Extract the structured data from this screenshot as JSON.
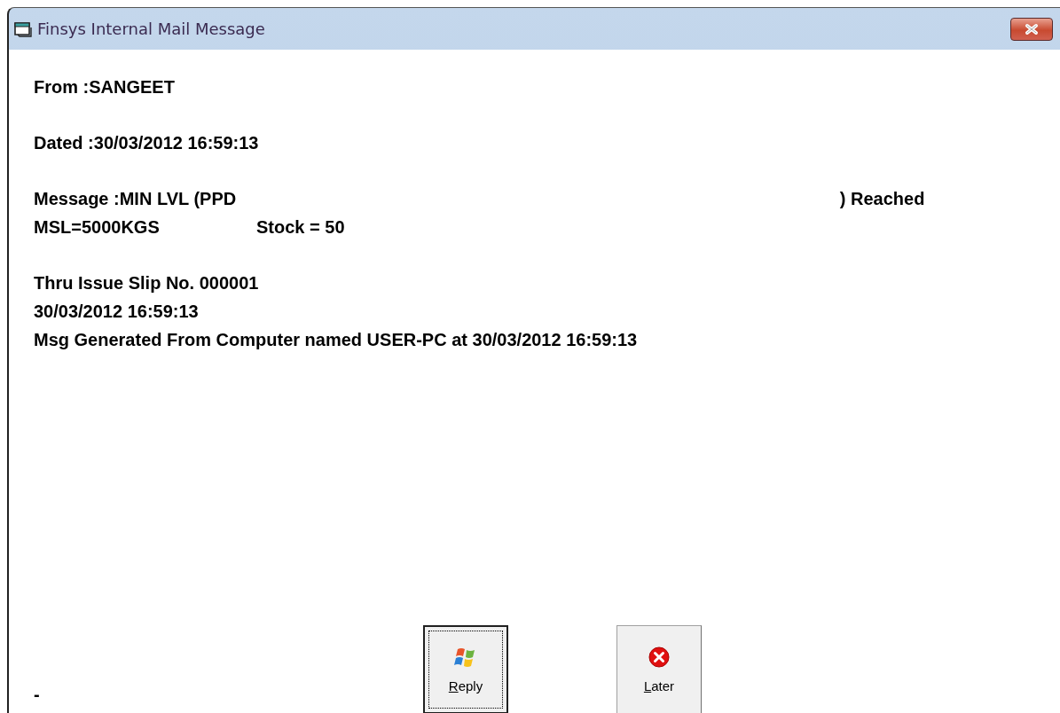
{
  "window": {
    "title": "Finsys Internal Mail Message"
  },
  "from": "From :SANGEET",
  "dated": "Dated :30/03/2012 16:59:13",
  "message": {
    "subject": "Message :MIN LVL (PPD",
    "subject_end": ") Reached",
    "msl": "MSL=5000KGS",
    "stock": "Stock = 50"
  },
  "details": [
    "Thru Issue Slip No. 000001",
    "30/03/2012 16:59:13",
    "Msg Generated From Computer named USER-PC at 30/03/2012 16:59:13"
  ],
  "status": "-",
  "buttons": [
    {
      "label": "Reply",
      "kind": "reply",
      "focused": true
    },
    {
      "label": "Later",
      "kind": "later",
      "focused": false
    }
  ]
}
